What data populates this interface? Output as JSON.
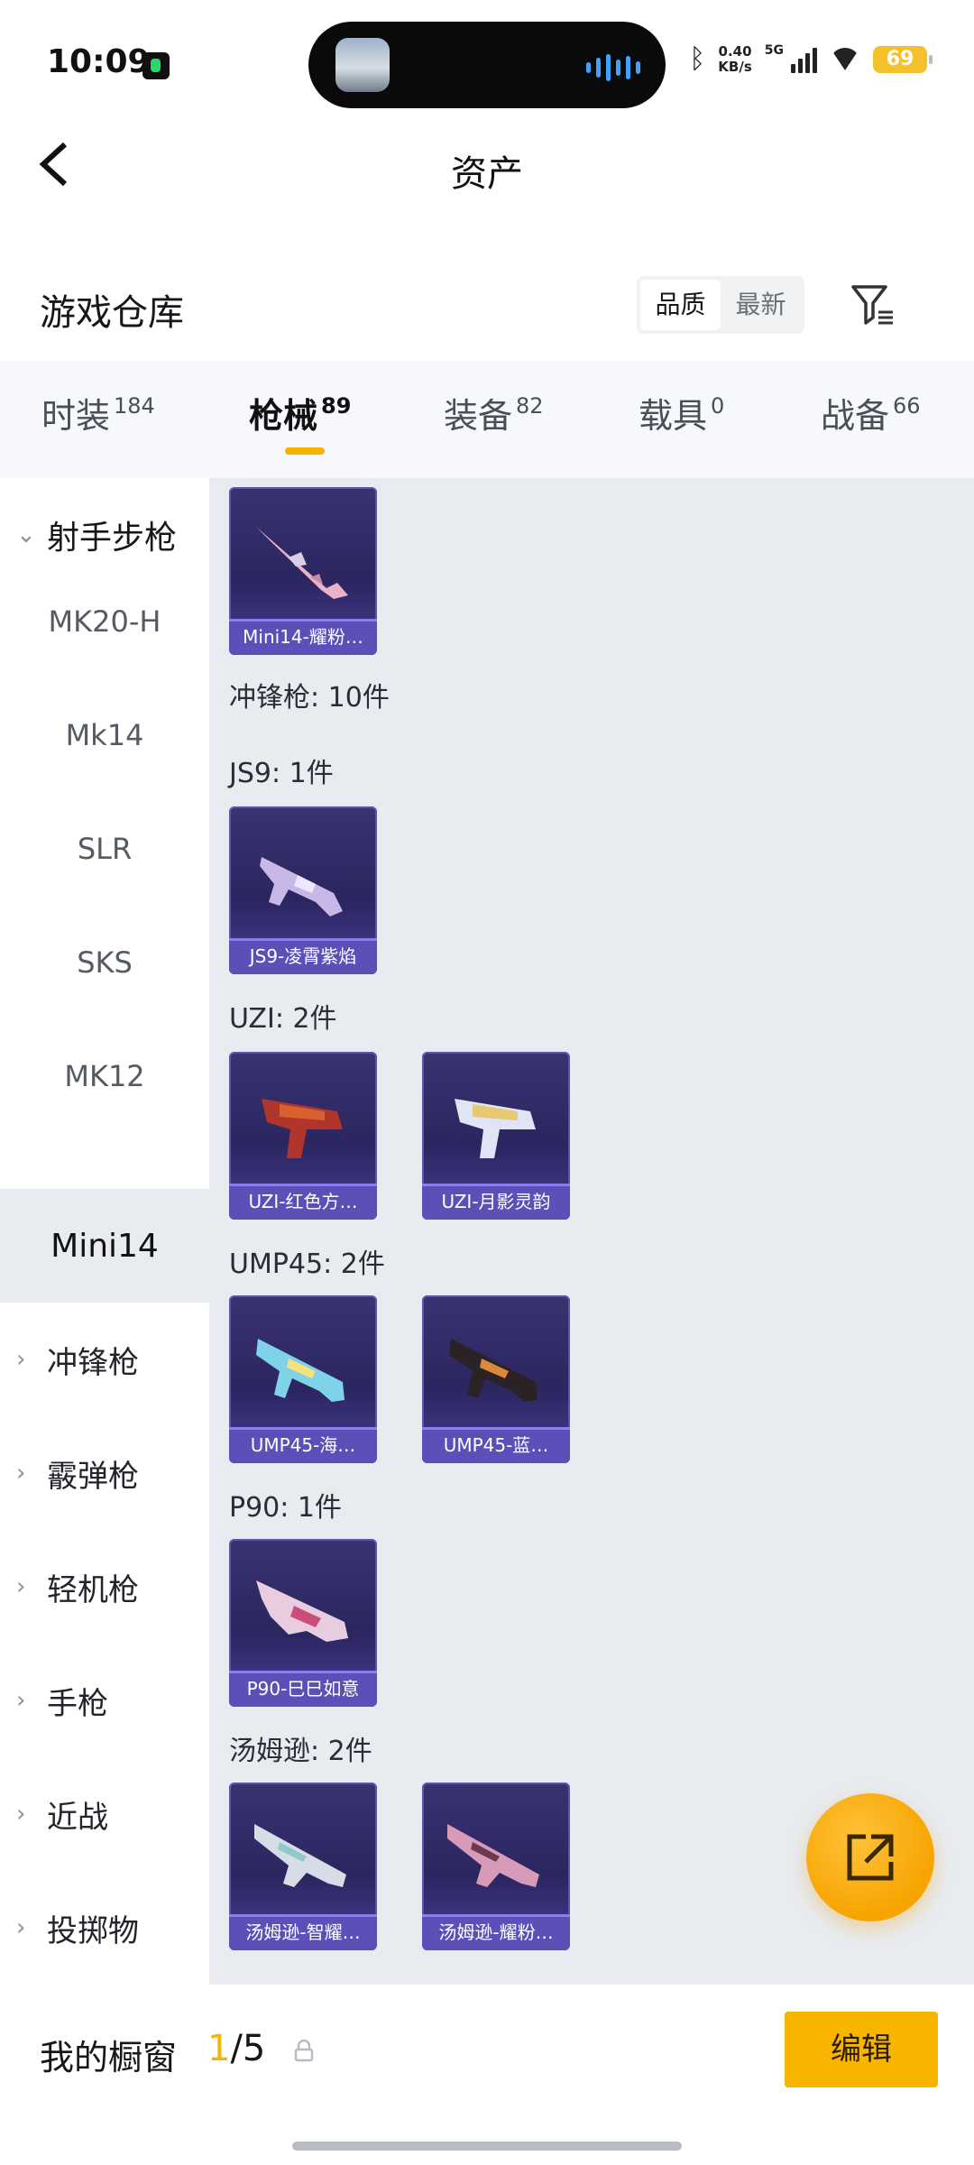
{
  "status_bar": {
    "time": "10:09",
    "speed_value": "0.40",
    "speed_unit": "KB/s",
    "network": "5G",
    "battery": "69"
  },
  "header": {
    "title": "资产"
  },
  "warehouse": {
    "title": "游戏仓库",
    "sort_options": [
      "品质",
      "最新"
    ],
    "sort_selected": "品质"
  },
  "tabs": [
    {
      "label": "时装",
      "count": "184"
    },
    {
      "label": "枪械",
      "count": "89"
    },
    {
      "label": "装备",
      "count": "82"
    },
    {
      "label": "载具",
      "count": "0"
    },
    {
      "label": "战备",
      "count": "66"
    }
  ],
  "active_tab": "枪械",
  "sidebar": {
    "items": [
      {
        "label": "射手步枪",
        "type": "group-open"
      },
      {
        "label": "MK20-H",
        "type": "sub"
      },
      {
        "label": "Mk14",
        "type": "sub"
      },
      {
        "label": "SLR",
        "type": "sub"
      },
      {
        "label": "SKS",
        "type": "sub"
      },
      {
        "label": "MK12",
        "type": "sub"
      },
      {
        "label": "Mini14",
        "type": "sub-active"
      },
      {
        "label": "冲锋枪",
        "type": "group"
      },
      {
        "label": "霰弹枪",
        "type": "group"
      },
      {
        "label": "轻机枪",
        "type": "group"
      },
      {
        "label": "手枪",
        "type": "group"
      },
      {
        "label": "近战",
        "type": "group"
      },
      {
        "label": "投掷物",
        "type": "group"
      }
    ]
  },
  "content": {
    "category_summary": "冲锋枪: 10件",
    "groups": [
      {
        "label": "",
        "items": [
          "Mini14-耀粉…"
        ]
      },
      {
        "label": "JS9: 1件",
        "items": [
          "JS9-凌霄紫焰"
        ]
      },
      {
        "label": "UZI: 2件",
        "items": [
          "UZI-红色方…",
          "UZI-月影灵韵"
        ]
      },
      {
        "label": "UMP45: 2件",
        "items": [
          "UMP45-海…",
          "UMP45-蓝…"
        ]
      },
      {
        "label": "P90: 1件",
        "items": [
          "P90-巳巳如意"
        ]
      },
      {
        "label": "汤姆逊: 2件",
        "items": [
          "汤姆逊-智耀…",
          "汤姆逊-耀粉…"
        ]
      }
    ]
  },
  "bottom_bar": {
    "showcase_label": "我的橱窗",
    "showcase_current": "1",
    "showcase_total": "/5",
    "edit_label": "编辑"
  },
  "colors": {
    "accent": "#f7b500",
    "card_bg": "#2b2560",
    "card_label_bg": "#5b4fb8",
    "content_bg": "#e8ebf0"
  },
  "icons": {
    "back": "chevron-left-icon",
    "filter": "filter-icon",
    "fab": "share-external-icon",
    "lock": "lock-icon"
  }
}
